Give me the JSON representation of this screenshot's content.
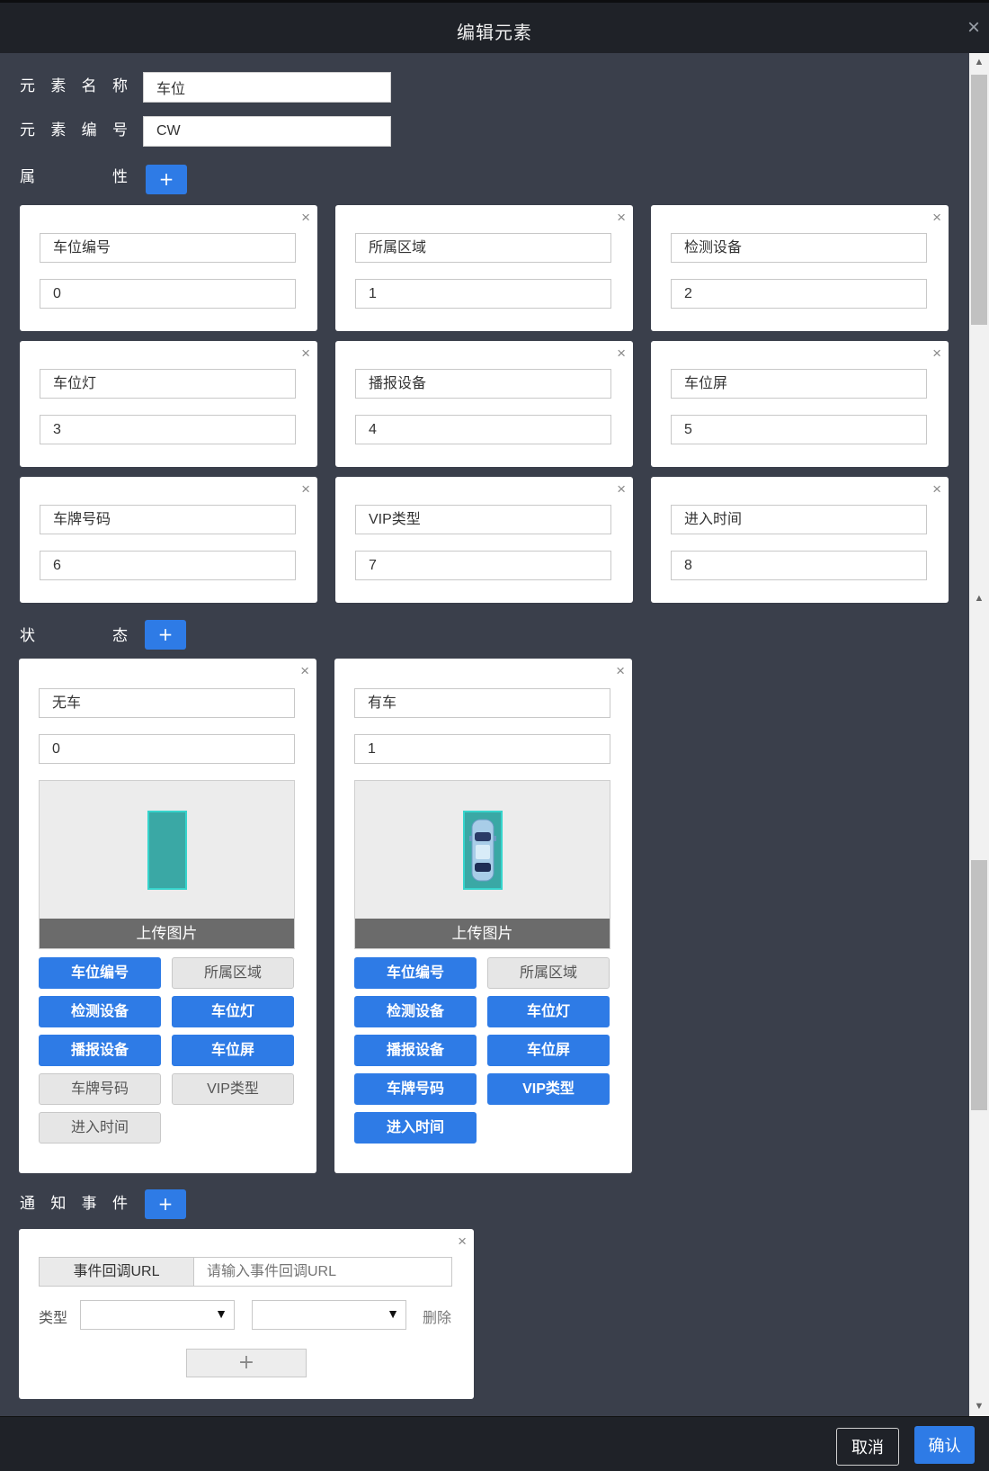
{
  "dialog": {
    "title": "编辑元素",
    "close_glyph": "×"
  },
  "element": {
    "name_label": [
      "元",
      "素",
      "名",
      "称"
    ],
    "name_value": "车位",
    "code_label": [
      "元",
      "素",
      "编",
      "号"
    ],
    "code_value": "CW"
  },
  "properties": {
    "label": [
      "属",
      "性"
    ],
    "add_glyph": "+",
    "items": [
      {
        "name": "车位编号",
        "value": "0"
      },
      {
        "name": "所属区域",
        "value": "1"
      },
      {
        "name": "检测设备",
        "value": "2"
      },
      {
        "name": "车位灯",
        "value": "3"
      },
      {
        "name": "播报设备",
        "value": "4"
      },
      {
        "name": "车位屏",
        "value": "5"
      },
      {
        "name": "车牌号码",
        "value": "6"
      },
      {
        "name": "VIP类型",
        "value": "7"
      },
      {
        "name": "进入时间",
        "value": "8"
      }
    ]
  },
  "states": {
    "label": [
      "状",
      "态"
    ],
    "add_glyph": "+",
    "upload_label": "上传图片",
    "items": [
      {
        "name": "无车",
        "value": "0",
        "image_icon": "empty-parking-slot-icon",
        "tags": [
          {
            "label": "车位编号",
            "active": true
          },
          {
            "label": "所属区域",
            "active": false
          },
          {
            "label": "检测设备",
            "active": true
          },
          {
            "label": "车位灯",
            "active": true
          },
          {
            "label": "播报设备",
            "active": true
          },
          {
            "label": "车位屏",
            "active": true
          },
          {
            "label": "车牌号码",
            "active": false
          },
          {
            "label": "VIP类型",
            "active": false
          },
          {
            "label": "进入时间",
            "active": false
          }
        ]
      },
      {
        "name": "有车",
        "value": "1",
        "image_icon": "car-in-slot-icon",
        "tags": [
          {
            "label": "车位编号",
            "active": true
          },
          {
            "label": "所属区域",
            "active": false
          },
          {
            "label": "检测设备",
            "active": true
          },
          {
            "label": "车位灯",
            "active": true
          },
          {
            "label": "播报设备",
            "active": true
          },
          {
            "label": "车位屏",
            "active": true
          },
          {
            "label": "车牌号码",
            "active": true
          },
          {
            "label": "VIP类型",
            "active": true
          },
          {
            "label": "进入时间",
            "active": true
          }
        ]
      }
    ]
  },
  "events": {
    "label": [
      "通",
      "知",
      "事",
      "件"
    ],
    "add_glyph": "+",
    "url_addon": "事件回调URL",
    "url_placeholder": "请输入事件回调URL",
    "type_label": "类型",
    "select_caret": "▼",
    "delete_label": "删除",
    "plus_glyph": "+"
  },
  "footer": {
    "cancel_label": "取消",
    "confirm_label": "确认"
  },
  "colors": {
    "primary": "#2e7be6",
    "panel_bg": "#3a3f4b",
    "bar_bg": "#1f2228",
    "slot_fill": "#3aa8a5"
  }
}
